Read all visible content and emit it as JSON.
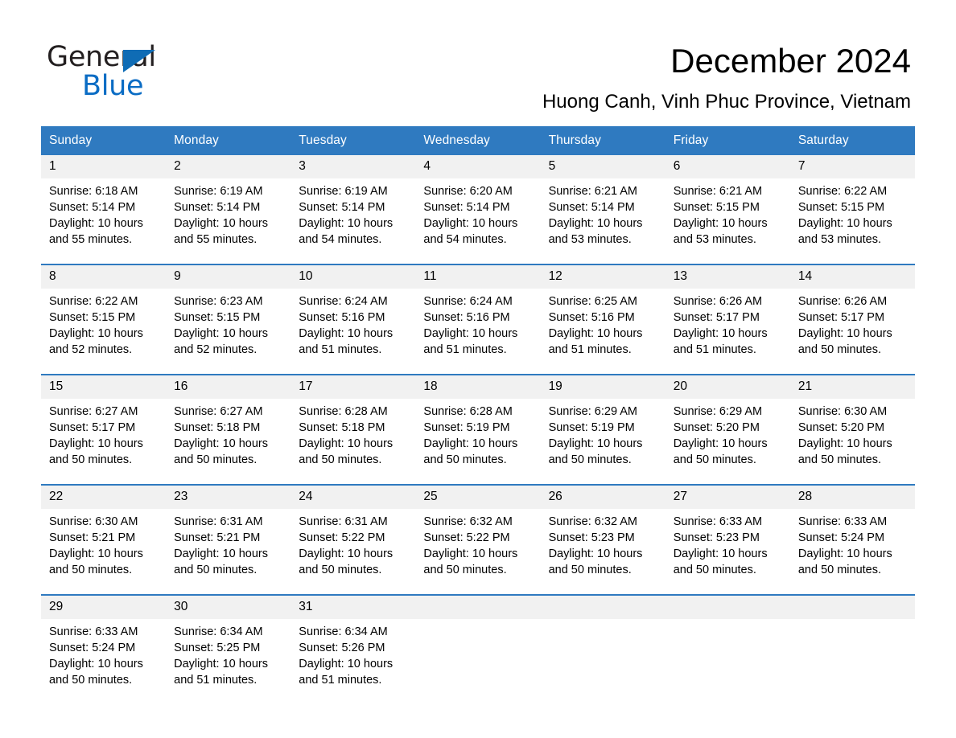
{
  "brand": {
    "name_part1": "General",
    "name_part2": "Blue",
    "accent_color": "#0f6cb5"
  },
  "header": {
    "title": "December 2024",
    "subtitle": "Huong Canh, Vinh Phuc Province, Vietnam"
  },
  "theme": {
    "header_blue": "#2f7ac0",
    "daynum_band": "#f1f1f1",
    "text": "#000000"
  },
  "calendar": {
    "weekday_headers": [
      "Sunday",
      "Monday",
      "Tuesday",
      "Wednesday",
      "Thursday",
      "Friday",
      "Saturday"
    ],
    "weeks": [
      [
        {
          "day": "1",
          "sunrise": "Sunrise: 6:18 AM",
          "sunset": "Sunset: 5:14 PM",
          "daylight_l1": "Daylight: 10 hours",
          "daylight_l2": "and 55 minutes."
        },
        {
          "day": "2",
          "sunrise": "Sunrise: 6:19 AM",
          "sunset": "Sunset: 5:14 PM",
          "daylight_l1": "Daylight: 10 hours",
          "daylight_l2": "and 55 minutes."
        },
        {
          "day": "3",
          "sunrise": "Sunrise: 6:19 AM",
          "sunset": "Sunset: 5:14 PM",
          "daylight_l1": "Daylight: 10 hours",
          "daylight_l2": "and 54 minutes."
        },
        {
          "day": "4",
          "sunrise": "Sunrise: 6:20 AM",
          "sunset": "Sunset: 5:14 PM",
          "daylight_l1": "Daylight: 10 hours",
          "daylight_l2": "and 54 minutes."
        },
        {
          "day": "5",
          "sunrise": "Sunrise: 6:21 AM",
          "sunset": "Sunset: 5:14 PM",
          "daylight_l1": "Daylight: 10 hours",
          "daylight_l2": "and 53 minutes."
        },
        {
          "day": "6",
          "sunrise": "Sunrise: 6:21 AM",
          "sunset": "Sunset: 5:15 PM",
          "daylight_l1": "Daylight: 10 hours",
          "daylight_l2": "and 53 minutes."
        },
        {
          "day": "7",
          "sunrise": "Sunrise: 6:22 AM",
          "sunset": "Sunset: 5:15 PM",
          "daylight_l1": "Daylight: 10 hours",
          "daylight_l2": "and 53 minutes."
        }
      ],
      [
        {
          "day": "8",
          "sunrise": "Sunrise: 6:22 AM",
          "sunset": "Sunset: 5:15 PM",
          "daylight_l1": "Daylight: 10 hours",
          "daylight_l2": "and 52 minutes."
        },
        {
          "day": "9",
          "sunrise": "Sunrise: 6:23 AM",
          "sunset": "Sunset: 5:15 PM",
          "daylight_l1": "Daylight: 10 hours",
          "daylight_l2": "and 52 minutes."
        },
        {
          "day": "10",
          "sunrise": "Sunrise: 6:24 AM",
          "sunset": "Sunset: 5:16 PM",
          "daylight_l1": "Daylight: 10 hours",
          "daylight_l2": "and 51 minutes."
        },
        {
          "day": "11",
          "sunrise": "Sunrise: 6:24 AM",
          "sunset": "Sunset: 5:16 PM",
          "daylight_l1": "Daylight: 10 hours",
          "daylight_l2": "and 51 minutes."
        },
        {
          "day": "12",
          "sunrise": "Sunrise: 6:25 AM",
          "sunset": "Sunset: 5:16 PM",
          "daylight_l1": "Daylight: 10 hours",
          "daylight_l2": "and 51 minutes."
        },
        {
          "day": "13",
          "sunrise": "Sunrise: 6:26 AM",
          "sunset": "Sunset: 5:17 PM",
          "daylight_l1": "Daylight: 10 hours",
          "daylight_l2": "and 51 minutes."
        },
        {
          "day": "14",
          "sunrise": "Sunrise: 6:26 AM",
          "sunset": "Sunset: 5:17 PM",
          "daylight_l1": "Daylight: 10 hours",
          "daylight_l2": "and 50 minutes."
        }
      ],
      [
        {
          "day": "15",
          "sunrise": "Sunrise: 6:27 AM",
          "sunset": "Sunset: 5:17 PM",
          "daylight_l1": "Daylight: 10 hours",
          "daylight_l2": "and 50 minutes."
        },
        {
          "day": "16",
          "sunrise": "Sunrise: 6:27 AM",
          "sunset": "Sunset: 5:18 PM",
          "daylight_l1": "Daylight: 10 hours",
          "daylight_l2": "and 50 minutes."
        },
        {
          "day": "17",
          "sunrise": "Sunrise: 6:28 AM",
          "sunset": "Sunset: 5:18 PM",
          "daylight_l1": "Daylight: 10 hours",
          "daylight_l2": "and 50 minutes."
        },
        {
          "day": "18",
          "sunrise": "Sunrise: 6:28 AM",
          "sunset": "Sunset: 5:19 PM",
          "daylight_l1": "Daylight: 10 hours",
          "daylight_l2": "and 50 minutes."
        },
        {
          "day": "19",
          "sunrise": "Sunrise: 6:29 AM",
          "sunset": "Sunset: 5:19 PM",
          "daylight_l1": "Daylight: 10 hours",
          "daylight_l2": "and 50 minutes."
        },
        {
          "day": "20",
          "sunrise": "Sunrise: 6:29 AM",
          "sunset": "Sunset: 5:20 PM",
          "daylight_l1": "Daylight: 10 hours",
          "daylight_l2": "and 50 minutes."
        },
        {
          "day": "21",
          "sunrise": "Sunrise: 6:30 AM",
          "sunset": "Sunset: 5:20 PM",
          "daylight_l1": "Daylight: 10 hours",
          "daylight_l2": "and 50 minutes."
        }
      ],
      [
        {
          "day": "22",
          "sunrise": "Sunrise: 6:30 AM",
          "sunset": "Sunset: 5:21 PM",
          "daylight_l1": "Daylight: 10 hours",
          "daylight_l2": "and 50 minutes."
        },
        {
          "day": "23",
          "sunrise": "Sunrise: 6:31 AM",
          "sunset": "Sunset: 5:21 PM",
          "daylight_l1": "Daylight: 10 hours",
          "daylight_l2": "and 50 minutes."
        },
        {
          "day": "24",
          "sunrise": "Sunrise: 6:31 AM",
          "sunset": "Sunset: 5:22 PM",
          "daylight_l1": "Daylight: 10 hours",
          "daylight_l2": "and 50 minutes."
        },
        {
          "day": "25",
          "sunrise": "Sunrise: 6:32 AM",
          "sunset": "Sunset: 5:22 PM",
          "daylight_l1": "Daylight: 10 hours",
          "daylight_l2": "and 50 minutes."
        },
        {
          "day": "26",
          "sunrise": "Sunrise: 6:32 AM",
          "sunset": "Sunset: 5:23 PM",
          "daylight_l1": "Daylight: 10 hours",
          "daylight_l2": "and 50 minutes."
        },
        {
          "day": "27",
          "sunrise": "Sunrise: 6:33 AM",
          "sunset": "Sunset: 5:23 PM",
          "daylight_l1": "Daylight: 10 hours",
          "daylight_l2": "and 50 minutes."
        },
        {
          "day": "28",
          "sunrise": "Sunrise: 6:33 AM",
          "sunset": "Sunset: 5:24 PM",
          "daylight_l1": "Daylight: 10 hours",
          "daylight_l2": "and 50 minutes."
        }
      ],
      [
        {
          "day": "29",
          "sunrise": "Sunrise: 6:33 AM",
          "sunset": "Sunset: 5:24 PM",
          "daylight_l1": "Daylight: 10 hours",
          "daylight_l2": "and 50 minutes."
        },
        {
          "day": "30",
          "sunrise": "Sunrise: 6:34 AM",
          "sunset": "Sunset: 5:25 PM",
          "daylight_l1": "Daylight: 10 hours",
          "daylight_l2": "and 51 minutes."
        },
        {
          "day": "31",
          "sunrise": "Sunrise: 6:34 AM",
          "sunset": "Sunset: 5:26 PM",
          "daylight_l1": "Daylight: 10 hours",
          "daylight_l2": "and 51 minutes."
        },
        {
          "day": "",
          "sunrise": "",
          "sunset": "",
          "daylight_l1": "",
          "daylight_l2": ""
        },
        {
          "day": "",
          "sunrise": "",
          "sunset": "",
          "daylight_l1": "",
          "daylight_l2": ""
        },
        {
          "day": "",
          "sunrise": "",
          "sunset": "",
          "daylight_l1": "",
          "daylight_l2": ""
        },
        {
          "day": "",
          "sunrise": "",
          "sunset": "",
          "daylight_l1": "",
          "daylight_l2": ""
        }
      ]
    ]
  }
}
